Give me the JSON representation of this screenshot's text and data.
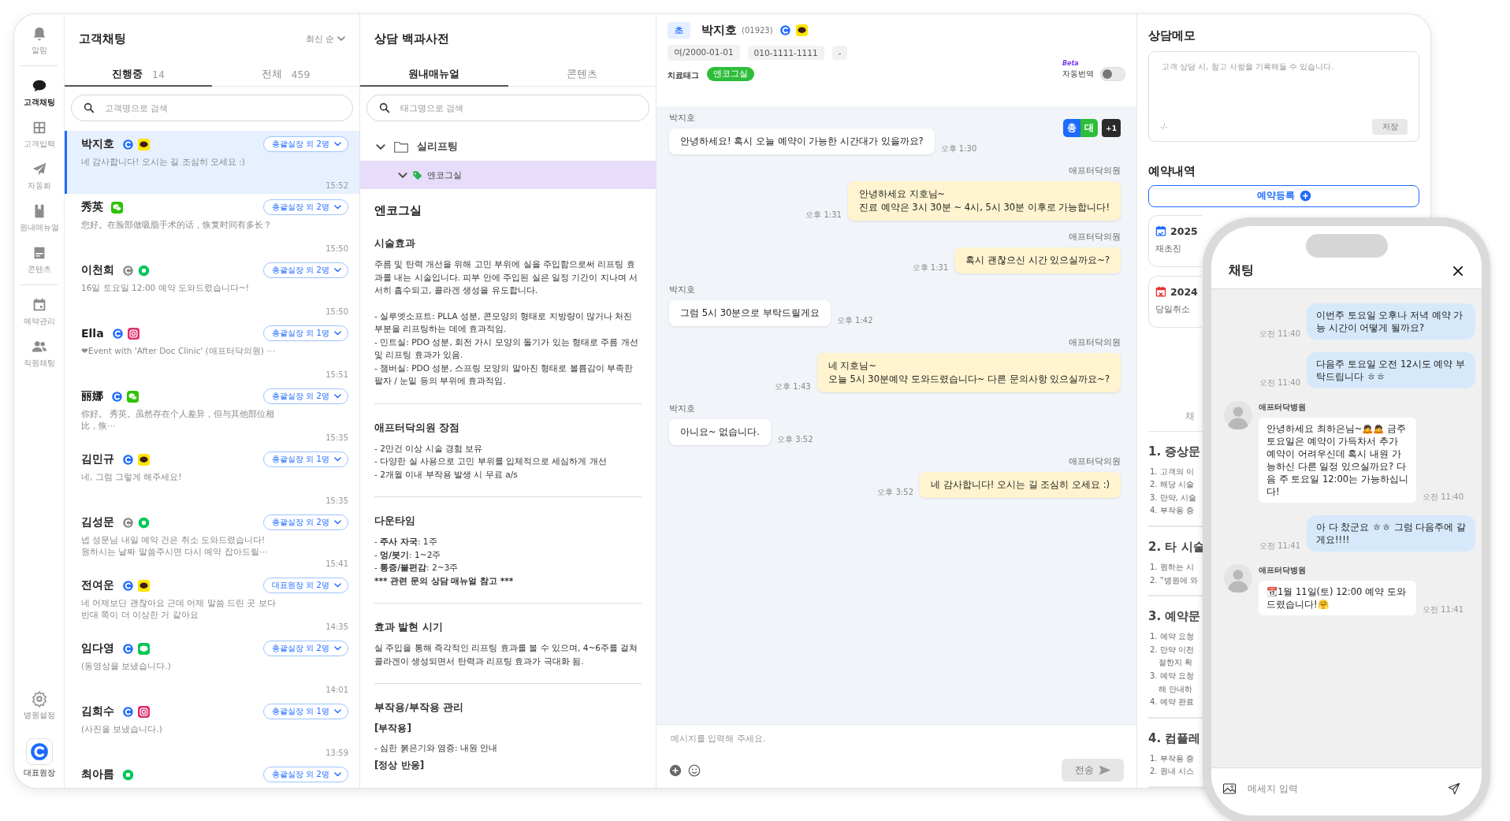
{
  "nav": {
    "groups": [
      [
        {
          "label": "알림",
          "selected": false
        }
      ],
      [
        {
          "label": "고객채팅",
          "selected": true
        },
        {
          "label": "고객입력",
          "selected": false
        },
        {
          "label": "자동화",
          "selected": false
        },
        {
          "label": "원내매뉴얼",
          "selected": false
        },
        {
          "label": "콘텐츠",
          "selected": false
        }
      ],
      [
        {
          "label": "예약관리",
          "selected": false
        },
        {
          "label": "직원채팅",
          "selected": false
        }
      ]
    ],
    "bottom": [
      {
        "label": "병원설정"
      },
      {
        "label": "대표원장"
      }
    ]
  },
  "customers": {
    "title": "고객채팅",
    "sort": "최신 순",
    "tabs": [
      {
        "label": "진행중",
        "count": "14",
        "selected": true
      },
      {
        "label": "전체",
        "count": "459",
        "selected": false
      }
    ],
    "search": {
      "placeholder": "고객명으로 검색"
    },
    "items": [
      {
        "name": "박지호",
        "channels": [
          {
            "kind": "afterdoc"
          },
          {
            "kind": "kakao"
          }
        ],
        "assignee": "총괄실장 외 2명",
        "message": "네 감사합니다! 오시는 길 조심히 오세요 :)",
        "time": "15:52",
        "selected": true
      },
      {
        "name": "秀英",
        "channels": [
          {
            "kind": "wechat"
          }
        ],
        "assignee": "총괄실장 외 2명",
        "message": "您好。在脸部做吸脂手术的话，恢复时间有多长？",
        "time": "15:50",
        "selected": false
      },
      {
        "name": "이천희",
        "channels": [
          {
            "kind": "afterdoc_off"
          },
          {
            "kind": "naver"
          }
        ],
        "assignee": "총괄실장 외 2명",
        "message": "16일 토요일 12:00 예약 도와드렸습니다~!",
        "time": "15:50",
        "selected": false
      },
      {
        "name": "Ella",
        "channels": [
          {
            "kind": "afterdoc"
          },
          {
            "kind": "instagram"
          }
        ],
        "assignee": "총괄실장 외 1명",
        "message": "❤Event with 'After Doc Clinic' (애프터닥의원) ⋯",
        "time": "15:51",
        "selected": false
      },
      {
        "name": "丽娜",
        "channels": [
          {
            "kind": "afterdoc"
          },
          {
            "kind": "wechat"
          }
        ],
        "assignee": "총괄실장 외 2명",
        "message": "你好。 秀英。虽然存在个人差异，但与其他部位相比，恢⋯",
        "time": "15:35",
        "selected": false
      },
      {
        "name": "김민규",
        "channels": [
          {
            "kind": "afterdoc"
          },
          {
            "kind": "kakao"
          }
        ],
        "assignee": "총괄실장 외 1명",
        "message": "네, 그럼 그렇게 해주세요!",
        "time": "15:35",
        "selected": false
      },
      {
        "name": "김성문",
        "channels": [
          {
            "kind": "afterdoc_off"
          },
          {
            "kind": "naver"
          }
        ],
        "assignee": "총괄실장 외 2명",
        "message": "넵 성문님 내일 예약 건은 취소 도와드렸습니다!\n원하시는 날짜 말씀주시면 다시 예약 잡아드릴⋯",
        "time": "15:41",
        "selected": false
      },
      {
        "name": "전여운",
        "channels": [
          {
            "kind": "afterdoc"
          },
          {
            "kind": "kakao"
          }
        ],
        "assignee": "대표원장 외 2명",
        "message": "네 어제보단 괜찮아요 근데 어제 말씀 드린 곳 보다 반대 쪽이 더 이상한 거 같아요",
        "time": "14:35",
        "selected": false
      },
      {
        "name": "임다영",
        "channels": [
          {
            "kind": "afterdoc"
          },
          {
            "kind": "line"
          }
        ],
        "assignee": "총괄실장 외 2명",
        "message": "(동영상을 보냈습니다.)",
        "time": "14:01",
        "selected": false
      },
      {
        "name": "김희수",
        "channels": [
          {
            "kind": "afterdoc"
          },
          {
            "kind": "instagram"
          }
        ],
        "assignee": "총괄실장 외 1명",
        "message": "(사진을 보냈습니다.)",
        "time": "13:59",
        "selected": false
      },
      {
        "name": "최아름",
        "channels": [
          {
            "kind": "naver"
          }
        ],
        "assignee": "총괄실장 외 2명",
        "selected": false
      }
    ]
  },
  "encyclopedia": {
    "title": "상담 백과사전",
    "tabs": [
      {
        "label": "원내매뉴얼",
        "selected": true
      },
      {
        "label": "콘텐츠",
        "selected": false
      }
    ],
    "search": {
      "placeholder": "태그명으로 검색"
    },
    "tree": [
      {
        "label": "실리프팅",
        "expanded": true,
        "selected": false,
        "children": [
          {
            "label": "엔코그실",
            "expanded": true,
            "selected": true
          }
        ]
      }
    ],
    "article": {
      "title": "엔코그실",
      "sections": [
        {
          "title": "시술효과",
          "lines": [
            {
              "kind": "text",
              "text": "주름 및 탄력 개선을 위해 고민 부위에 실을 주입함으로써 리프팅 효과를 내는 시술입니다. 피부 안에 주입된 실은 일정 기간이 지나며 서서히 흡수되고, 콜라겐 생성을 유도합니다."
            },
            {
              "kind": "bullet",
              "text": "- 실루엣소프트: PLLA 성분, 콘모양의 형태로 지방량이 많거나 처진 부분을 리프팅하는 데에 효과적임."
            },
            {
              "kind": "bullet",
              "text": "- 민트실: PDO 성분, 회전 가시 모양의 돌기가 있는 형태로 주름 개선 및 리프팅 효과가 있음."
            },
            {
              "kind": "bullet",
              "text": "- 잼버실: PDO 성분, 스프링 모양의 말아진 형태로 볼륨감이 부족한 팔자 / 눈밑 등의 부위에 효과적임."
            }
          ]
        },
        {
          "title": "애프터닥의원 장점",
          "lines": [
            {
              "kind": "bullet",
              "text": "- 2만건 이상 시술 경험 보유"
            },
            {
              "kind": "bullet",
              "text": "- 다양한 실 사용으로 고민 부위를 입체적으로 세심하게 개선"
            },
            {
              "kind": "bullet",
              "text": "- 2개월 이내 부작용 발생 시 무료 a/s"
            }
          ]
        },
        {
          "title": "다운타임",
          "lines": [
            {
              "kind": "bullet",
              "text": "- **주사 자국**: 1주"
            },
            {
              "kind": "bullet",
              "text": "- **멍/붓기**: 1~2주"
            },
            {
              "kind": "bullet",
              "text": "- **통증/불편감**: 2~3주"
            },
            {
              "kind": "note",
              "text": "*** 관련 문의 상담 매뉴얼 참고 ***"
            }
          ]
        },
        {
          "title": "효과 발현 시기",
          "lines": [
            {
              "kind": "text",
              "text": "실 주입을 통해 즉각적인 리프팅 효과를 볼 수 있으며, 4~6주를 걸쳐 콜라겐이 생성되면서 탄력과 리프팅 효과가 극대화 됨."
            }
          ]
        },
        {
          "title": "부작용/부작용 관리",
          "lines": [
            {
              "kind": "sub",
              "text": "[부작용]"
            },
            {
              "kind": "bullet",
              "text": "- 심한 붉은기와 염증: 내원 안내"
            },
            {
              "kind": "sub",
              "text": "[정상 반응]"
            }
          ]
        }
      ]
    }
  },
  "chat": {
    "header": {
      "grade": "초",
      "name": "박지호",
      "id": "(01923)",
      "channels": [
        {
          "kind": "afterdoc"
        },
        {
          "kind": "kakao"
        }
      ],
      "chips": [
        "여/2000-01-01",
        "010-1111-1111",
        "-"
      ],
      "tag_label": "치료태그",
      "tags": [
        "엔코그실"
      ],
      "beta": "Beta",
      "translate": {
        "label": "자동번역",
        "on": false
      }
    },
    "assignees": [
      {
        "label": "총",
        "color": "#1f6bff"
      },
      {
        "label": "대",
        "color": "#2dbd3a"
      },
      {
        "label": "+1",
        "color": "#2b2b2b"
      }
    ],
    "messages": [
      {
        "kind": "customer",
        "sender": "박지호",
        "text": "안녕하세요! 혹시 오늘 예약이 가능한 시간대가 있을까요?",
        "time": "오후 1:30"
      },
      {
        "kind": "hospital",
        "sender": "애프터닥의원",
        "text": "안녕하세요 지호님~\n진료 예약은 3시 30분 ~ 4시, 5시 30분 이후로 가능합니다!",
        "time": "오후 1:31"
      },
      {
        "kind": "hospital",
        "sender": "애프터닥의원",
        "text": "혹시 괜찮으신 시간 있으실까요~?",
        "time": "오후 1:31"
      },
      {
        "kind": "customer",
        "sender": "박지호",
        "text": "그럼 5시 30분으로 부탁드릴게요",
        "time": "오후 1:42"
      },
      {
        "kind": "hospital",
        "sender": "애프터닥의원",
        "text": "네 지호님~\n오늘 5시 30분예약 도와드렸습니다~ 다른 문의사항 있으실까요~?",
        "time": "오후 1:43"
      },
      {
        "kind": "customer",
        "sender": "박지호",
        "text": "아니요~ 없습니다.",
        "time": "오후 3:52"
      },
      {
        "kind": "hospital",
        "sender": "애프터닥의원",
        "text": "네 감사합니다! 오시는 길 조심히 오세요 :)",
        "time": "오후 3:52"
      }
    ],
    "input": {
      "placeholder": "메시지를 입력해 주세요.",
      "send": "전송",
      "send_disabled": true
    }
  },
  "memo": {
    "title": "상담메모",
    "placeholder": "고객 상담 시, 참고 사항을 기록해둘 수 있습니다.",
    "counter": "-/-",
    "save": "저장",
    "save_disabled": true
  },
  "reservations": {
    "title": "예약내역",
    "add": "예약등록",
    "items": [
      {
        "kind": "visit",
        "date": "2025",
        "status": "재초진"
      },
      {
        "kind": "cancelled",
        "date": "2024",
        "status": "당일취소"
      }
    ]
  },
  "guide": {
    "tab": "채",
    "sections": [
      {
        "title": "1. 증상문",
        "items": [
          {
            "kind": "item",
            "text": "1. 고객의 이"
          },
          {
            "kind": "item",
            "text": "2. 해당 시술"
          },
          {
            "kind": "item",
            "text": "3. 만약, 시술"
          },
          {
            "kind": "item",
            "text": "4. 부작용 증"
          }
        ]
      },
      {
        "title": "2. 타 시술",
        "items": [
          {
            "kind": "item",
            "text": "1. 원하는 시"
          },
          {
            "kind": "item",
            "text": "2. “병원에 와"
          }
        ]
      },
      {
        "title": "3. 예약문",
        "items": [
          {
            "kind": "item",
            "text": "1. 예약 요청"
          },
          {
            "kind": "item",
            "text": "2. 만약 이전"
          },
          {
            "kind": "cont",
            "text": "절한지 확"
          },
          {
            "kind": "item",
            "text": "3. 예약 요청"
          },
          {
            "kind": "cont",
            "text": "해 안내하"
          },
          {
            "kind": "item",
            "text": "4. 예약 완료"
          }
        ]
      },
      {
        "title": "4. 컴플레",
        "items": [
          {
            "kind": "item",
            "text": "1. 부작용 증"
          },
          {
            "kind": "item",
            "text": "2. 원내 시스"
          }
        ]
      }
    ]
  },
  "phone": {
    "title": "채팅",
    "messages": [
      {
        "kind": "me",
        "text": "이번주 토요일 오후나 저녁 예약 가능 시간이 어떻게 될까요?",
        "time": "오전 11:40"
      },
      {
        "kind": "me",
        "text": "다음주 토요일 오전 12시도 예약 부탁드립니다 ㅎㅎ",
        "time": "오전 11:40"
      },
      {
        "kind": "hospital",
        "sender": "애프터닥병원",
        "text": "안녕하세요 최하은님~🙇🙇 금주 토요일은 예약이 가득차서 추가 예약이 어려우신데 혹시 내원 가능하신 다른 일정 있으실까요? 다음 주 토요일 12:00는 가능하십니다!",
        "time": "오전 11:40"
      },
      {
        "kind": "me",
        "text": "아 다 찼군요 ㅎㅎ 그럼 다음주에 갈게요!!!!",
        "time": "오전 11:41"
      },
      {
        "kind": "hospital",
        "sender": "애프터닥병원",
        "text": "📆1월 11일(토) 12:00 예약 도와드렸습니다!🤗",
        "time": "오전 11:41"
      }
    ],
    "input": {
      "placeholder": "메세지 입력"
    }
  }
}
